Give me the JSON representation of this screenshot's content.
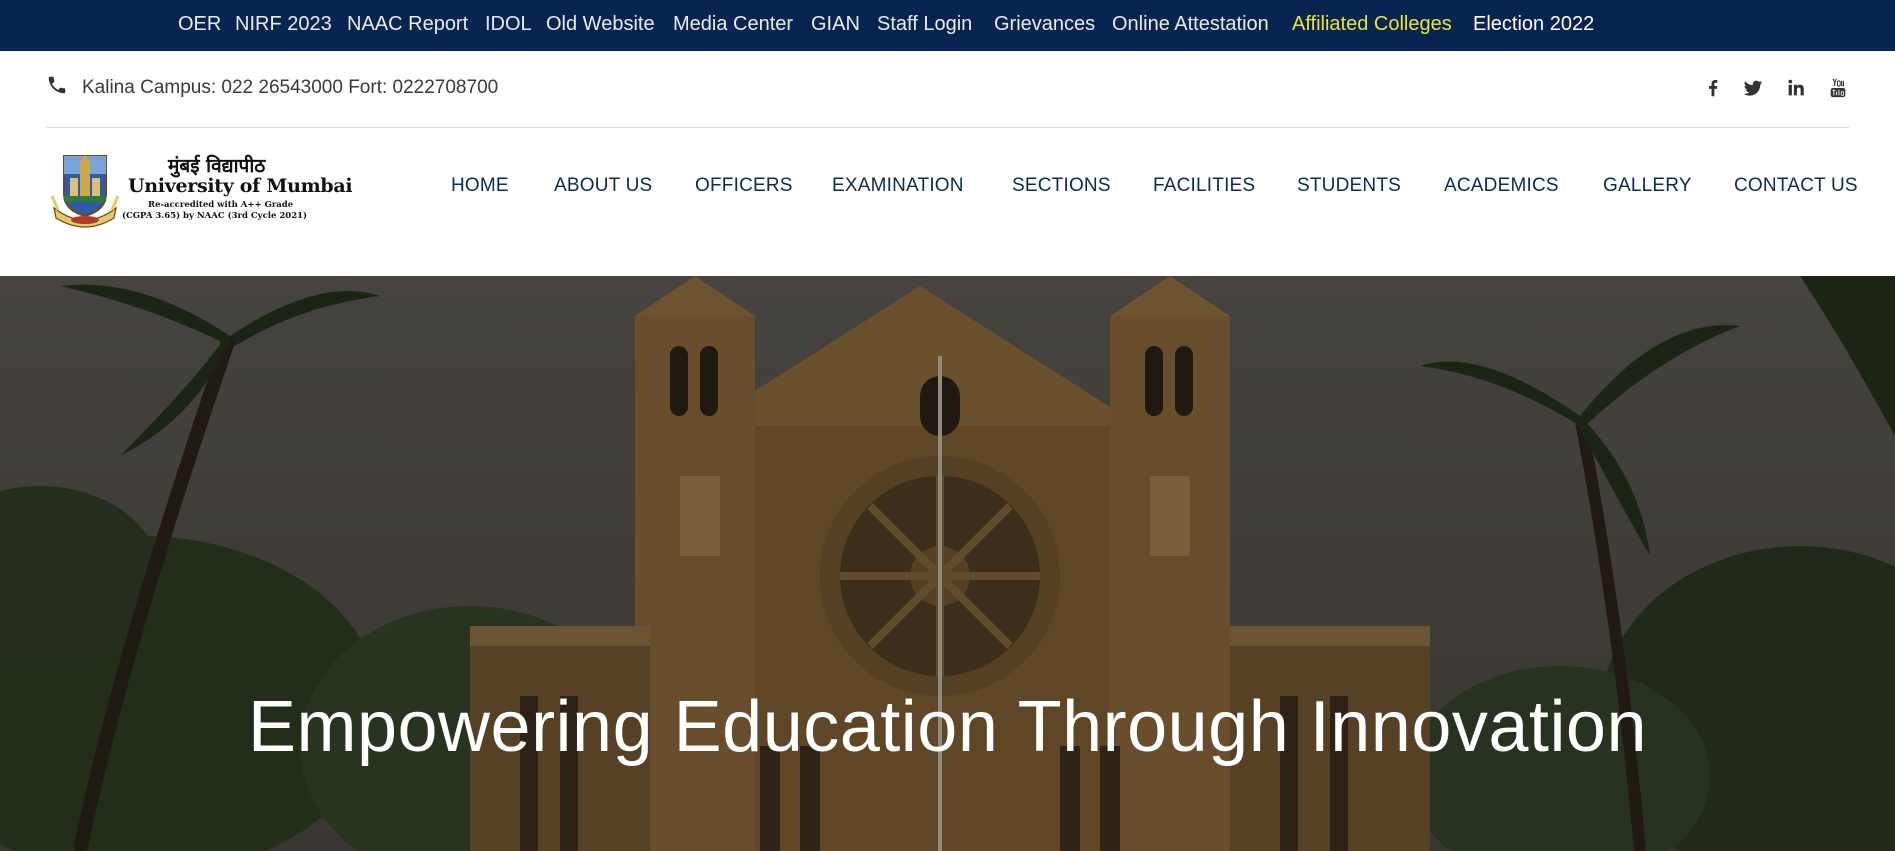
{
  "top_links": [
    {
      "label": "OER"
    },
    {
      "label": "NIRF 2023"
    },
    {
      "label": "NAAC Report"
    },
    {
      "label": "IDOL"
    },
    {
      "label": "Old Website"
    },
    {
      "label": "Media Center"
    },
    {
      "label": "GIAN"
    },
    {
      "label": "Staff Login"
    },
    {
      "label": "Grievances"
    },
    {
      "label": "Online Attestation"
    },
    {
      "label": "Affiliated Colleges"
    },
    {
      "label": "Election 2022"
    }
  ],
  "contact": {
    "icon": "phone-icon",
    "text": "Kalina Campus: 022 26543000 Fort: 0222708700"
  },
  "social": [
    "facebook-icon",
    "twitter-icon",
    "linkedin-icon",
    "youtube-icon"
  ],
  "logo": {
    "hindi": "मुंबई विद्यापीठ",
    "english": "University of Mumbai",
    "line1": "Re-accredited with A++ Grade",
    "line2": "(CGPA 3.65) by NAAC (3rd Cycle 2021)"
  },
  "nav": [
    {
      "label": "HOME"
    },
    {
      "label": "ABOUT US"
    },
    {
      "label": "OFFICERS"
    },
    {
      "label": "EXAMINATION"
    },
    {
      "label": "SECTIONS"
    },
    {
      "label": "FACILITIES"
    },
    {
      "label": "STUDENTS"
    },
    {
      "label": "ACADEMICS"
    },
    {
      "label": "GALLERY"
    },
    {
      "label": "CONTACT US"
    }
  ],
  "hero": {
    "title": "Empowering Education Through Innovation"
  },
  "colors": {
    "topbar_bg": "#0a2451",
    "highlight_link": "#e7e53a",
    "nav_text": "#0c2a55"
  }
}
